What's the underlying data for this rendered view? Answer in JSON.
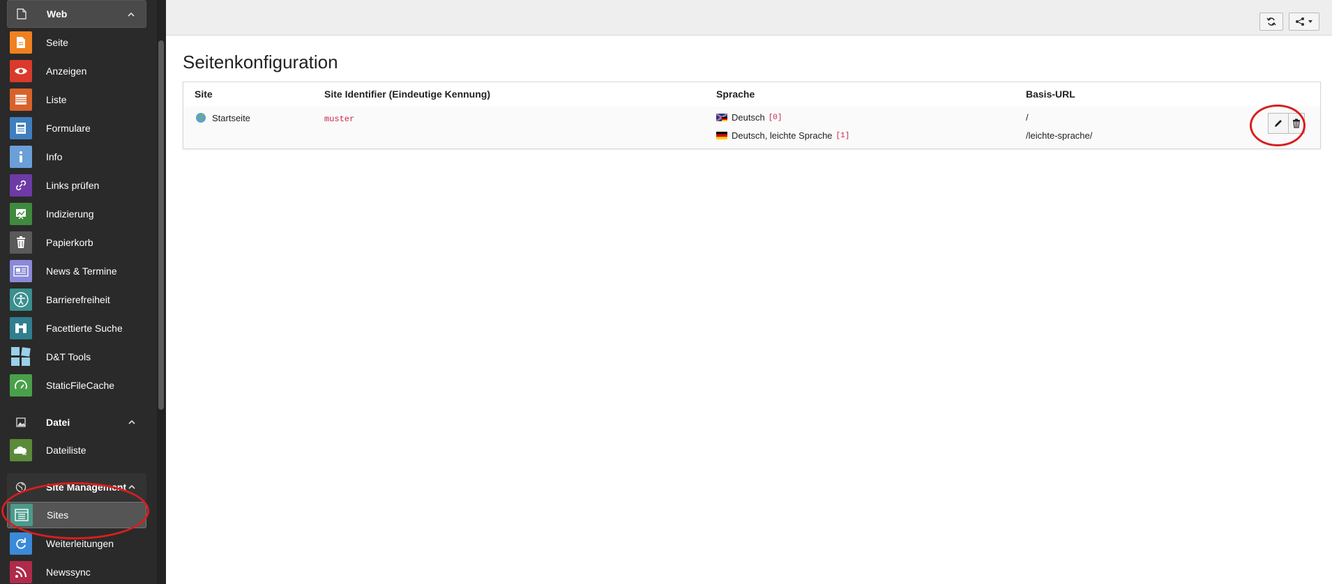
{
  "sidebar": {
    "groups": [
      {
        "label": "Web"
      },
      {
        "label": "Datei"
      },
      {
        "label": "Site Management"
      }
    ],
    "items": [
      {
        "label": "Seite",
        "color": "#f08020",
        "icon": "page-icon"
      },
      {
        "label": "Anzeigen",
        "color": "#d93a2b",
        "icon": "eye-icon"
      },
      {
        "label": "Liste",
        "color": "#d9622b",
        "icon": "list-icon"
      },
      {
        "label": "Formulare",
        "color": "#3f7fbf",
        "icon": "form-icon"
      },
      {
        "label": "Info",
        "color": "#6a9fd8",
        "icon": "info-icon"
      },
      {
        "label": "Links prüfen",
        "color": "#6d3aa6",
        "icon": "link-icon"
      },
      {
        "label": "Indizierung",
        "color": "#3f8a3f",
        "icon": "chart-icon"
      },
      {
        "label": "Papierkorb",
        "color": "#5a5a5a",
        "icon": "trash-icon"
      },
      {
        "label": "News & Termine",
        "color": "#8a8ad8",
        "icon": "news-icon"
      },
      {
        "label": "Barrierefreiheit",
        "color": "#3a8f8f",
        "icon": "accessibility-icon"
      },
      {
        "label": "Facettierte Suche",
        "color": "#2f7f8f",
        "icon": "binoculars-icon"
      },
      {
        "label": "D&T Tools",
        "color": "#5aa0c8",
        "icon": "tools-icon"
      },
      {
        "label": "StaticFileCache",
        "color": "#4aa04a",
        "icon": "gauge-icon"
      },
      {
        "label": "Dateiliste",
        "color": "#5a8a3a",
        "icon": "filelist-icon"
      },
      {
        "label": "Sites",
        "color": "#4a9a8a",
        "icon": "sites-icon"
      },
      {
        "label": "Weiterleitungen",
        "color": "#3a8ad8",
        "icon": "redirect-icon"
      },
      {
        "label": "Newssync",
        "color": "#b02a4a",
        "icon": "rss-icon"
      }
    ]
  },
  "main": {
    "title": "Seitenkonfiguration",
    "table": {
      "headers": [
        "Site",
        "Site Identifier (Eindeutige Kennung)",
        "Sprache",
        "Basis-URL"
      ],
      "row": {
        "site": "Startseite",
        "identifier": "muster",
        "languages": [
          {
            "name": "Deutsch",
            "index": "[0]",
            "url": "/"
          },
          {
            "name": "Deutsch, leichte Sprache",
            "index": "[1]",
            "url": "/leichte-sprache/"
          }
        ]
      }
    }
  }
}
